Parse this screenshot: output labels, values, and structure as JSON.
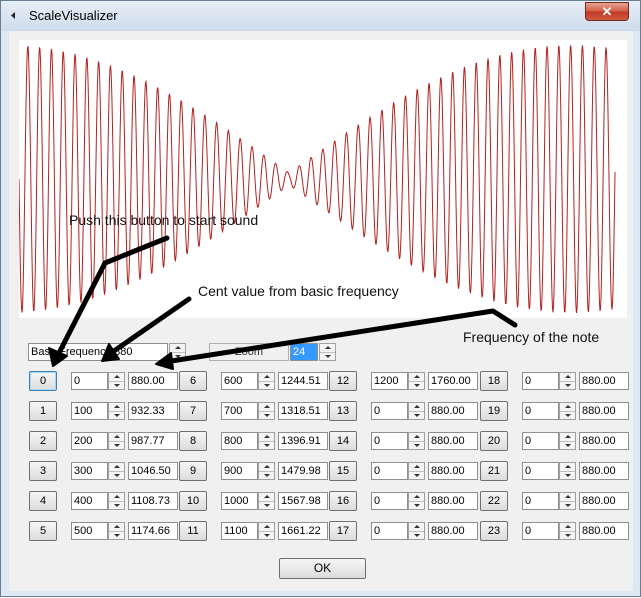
{
  "window": {
    "title": "ScaleVisualizer",
    "close_glyph": "✕"
  },
  "base": {
    "label": "Base Frequency",
    "value": "880"
  },
  "zoom": {
    "label": "Zoom",
    "value": "24"
  },
  "annotations": {
    "start_sound": "Push this button to start sound",
    "cent_value": "Cent value from basic frequency",
    "frequency": "Frequency of the note"
  },
  "notes": [
    {
      "index": "0",
      "cent": "0",
      "freq": "880.00"
    },
    {
      "index": "1",
      "cent": "100",
      "freq": "932.33"
    },
    {
      "index": "2",
      "cent": "200",
      "freq": "987.77"
    },
    {
      "index": "3",
      "cent": "300",
      "freq": "1046.50"
    },
    {
      "index": "4",
      "cent": "400",
      "freq": "1108.73"
    },
    {
      "index": "5",
      "cent": "500",
      "freq": "1174.66"
    },
    {
      "index": "6",
      "cent": "600",
      "freq": "1244.51"
    },
    {
      "index": "7",
      "cent": "700",
      "freq": "1318.51"
    },
    {
      "index": "8",
      "cent": "800",
      "freq": "1396.91"
    },
    {
      "index": "9",
      "cent": "900",
      "freq": "1479.98"
    },
    {
      "index": "10",
      "cent": "1000",
      "freq": "1567.98"
    },
    {
      "index": "11",
      "cent": "1100",
      "freq": "1661.22"
    },
    {
      "index": "12",
      "cent": "1200",
      "freq": "1760.00"
    },
    {
      "index": "13",
      "cent": "0",
      "freq": "880.00"
    },
    {
      "index": "14",
      "cent": "0",
      "freq": "880.00"
    },
    {
      "index": "15",
      "cent": "0",
      "freq": "880.00"
    },
    {
      "index": "16",
      "cent": "0",
      "freq": "880.00"
    },
    {
      "index": "17",
      "cent": "0",
      "freq": "880.00"
    },
    {
      "index": "18",
      "cent": "0",
      "freq": "880.00"
    },
    {
      "index": "19",
      "cent": "0",
      "freq": "880.00"
    },
    {
      "index": "20",
      "cent": "0",
      "freq": "880.00"
    },
    {
      "index": "21",
      "cent": "0",
      "freq": "880.00"
    },
    {
      "index": "22",
      "cent": "0",
      "freq": "880.00"
    },
    {
      "index": "23",
      "cent": "0",
      "freq": "880.00"
    }
  ],
  "ok_label": "OK",
  "colors": {
    "waveform": "#b22222",
    "arrow": "#000000"
  }
}
